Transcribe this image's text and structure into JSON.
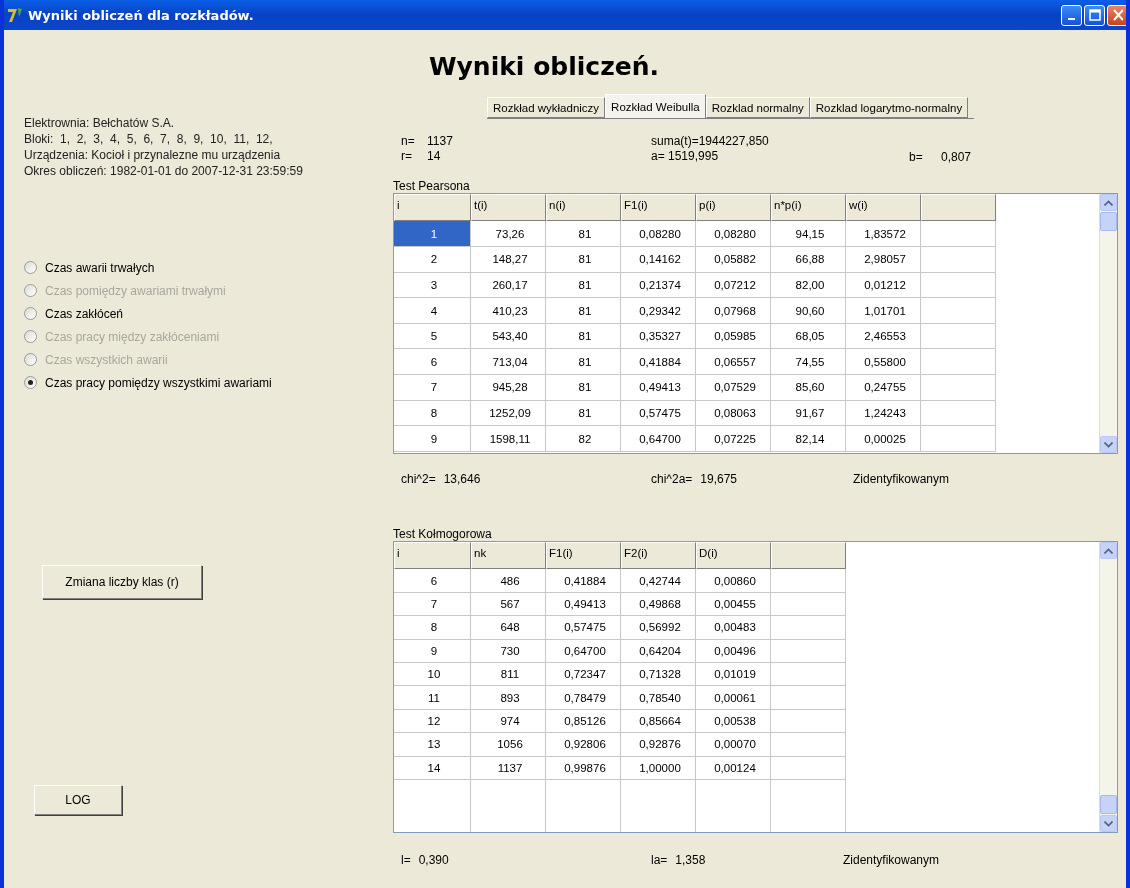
{
  "window": {
    "title": "Wyniki obliczeń dla rozkładów."
  },
  "heading": "Wyniki obliczeń.",
  "info": [
    "Elektrownia: Bełchatów S.A.",
    "Bloki:  1,  2,  3,  4,  5,  6,  7,  8,  9,  10,  11,  12,",
    "Urządzenia: Kocioł i przynalezne mu urządzenia",
    "Okres obliczeń: 1982-01-01 do 2007-12-31 23:59:59"
  ],
  "options": [
    {
      "label": "Czas awarii trwałych",
      "selected": false,
      "disabled": false
    },
    {
      "label": "Czas pomiędzy awariami trwałymi",
      "selected": false,
      "disabled": true
    },
    {
      "label": "Czas zakłóceń",
      "selected": false,
      "disabled": false
    },
    {
      "label": "Czas pracy między zakłóceniami",
      "selected": false,
      "disabled": true
    },
    {
      "label": "Czas wszystkich awarii",
      "selected": false,
      "disabled": true
    },
    {
      "label": "Czas pracy pomiędzy wszystkimi awariami",
      "selected": true,
      "disabled": false
    }
  ],
  "change_classes_button": {
    "label": "Zmiana liczby klas (r)"
  },
  "log_button": {
    "label": "LOG"
  },
  "tabs": [
    {
      "label": "Rozkład wykładniczy",
      "selected": false
    },
    {
      "label": "Rozkład Weibulla",
      "selected": true
    },
    {
      "label": "Rozklad normalny",
      "selected": false
    },
    {
      "label": "Rozklad logarytmo-normalny",
      "selected": false
    }
  ],
  "stats": {
    "n": {
      "label": "n=",
      "value": "1137"
    },
    "r": {
      "label": "r=",
      "value": "14"
    },
    "suma": "suma(t)=1944227,850",
    "a": "a= 1519,995",
    "b": {
      "label": "b=",
      "value": "0,807"
    }
  },
  "pearson": {
    "title": "Test Pearsona",
    "columns": [
      "i",
      "t(i)",
      "n(i)",
      "F1(i)",
      "p(i)",
      "n*p(i)",
      "w(i)"
    ],
    "rows": [
      {
        "cells": [
          "1",
          "73,26",
          "81",
          "0,08280",
          "0,08280",
          "94,15",
          "1,83572"
        ],
        "selected": true
      },
      {
        "cells": [
          "2",
          "148,27",
          "81",
          "0,14162",
          "0,05882",
          "66,88",
          "2,98057"
        ],
        "selected": false
      },
      {
        "cells": [
          "3",
          "260,17",
          "81",
          "0,21374",
          "0,07212",
          "82,00",
          "0,01212"
        ],
        "selected": false
      },
      {
        "cells": [
          "4",
          "410,23",
          "81",
          "0,29342",
          "0,07968",
          "90,60",
          "1,01701"
        ],
        "selected": false
      },
      {
        "cells": [
          "5",
          "543,40",
          "81",
          "0,35327",
          "0,05985",
          "68,05",
          "2,46553"
        ],
        "selected": false
      },
      {
        "cells": [
          "6",
          "713,04",
          "81",
          "0,41884",
          "0,06557",
          "74,55",
          "0,55800"
        ],
        "selected": false
      },
      {
        "cells": [
          "7",
          "945,28",
          "81",
          "0,49413",
          "0,07529",
          "85,60",
          "0,24755"
        ],
        "selected": false
      },
      {
        "cells": [
          "8",
          "1252,09",
          "81",
          "0,57475",
          "0,08063",
          "91,67",
          "1,24243"
        ],
        "selected": false
      },
      {
        "cells": [
          "9",
          "1598,11",
          "82",
          "0,64700",
          "0,07225",
          "82,14",
          "0,00025"
        ],
        "selected": false
      }
    ],
    "result": {
      "stat": {
        "label": "chi^2=",
        "value": "13,646"
      },
      "critical": {
        "label": "chi^2a=",
        "value": "19,675"
      },
      "verdict": "Zidentyfikowanym"
    }
  },
  "kolmogorov": {
    "title": "Test Kołmogorowa",
    "columns": [
      "i",
      "nk",
      "F1(i)",
      "F2(i)",
      "D(i)"
    ],
    "rows": [
      {
        "cells": [
          "6",
          "486",
          "0,41884",
          "0,42744",
          "0,00860"
        ],
        "selected": false
      },
      {
        "cells": [
          "7",
          "567",
          "0,49413",
          "0,49868",
          "0,00455"
        ],
        "selected": false
      },
      {
        "cells": [
          "8",
          "648",
          "0,57475",
          "0,56992",
          "0,00483"
        ],
        "selected": false
      },
      {
        "cells": [
          "9",
          "730",
          "0,64700",
          "0,64204",
          "0,00496"
        ],
        "selected": false
      },
      {
        "cells": [
          "10",
          "811",
          "0,72347",
          "0,71328",
          "0,01019"
        ],
        "selected": false
      },
      {
        "cells": [
          "11",
          "893",
          "0,78479",
          "0,78540",
          "0,00061"
        ],
        "selected": false
      },
      {
        "cells": [
          "12",
          "974",
          "0,85126",
          "0,85664",
          "0,00538"
        ],
        "selected": false
      },
      {
        "cells": [
          "13",
          "1056",
          "0,92806",
          "0,92876",
          "0,00070"
        ],
        "selected": false
      },
      {
        "cells": [
          "14",
          "1137",
          "0,99876",
          "1,00000",
          "0,00124"
        ],
        "selected": false
      }
    ],
    "result": {
      "stat": {
        "label": "l=",
        "value": "0,390"
      },
      "critical": {
        "label": "la=",
        "value": "1,358"
      },
      "verdict": "Zidentyfikowanym"
    }
  }
}
